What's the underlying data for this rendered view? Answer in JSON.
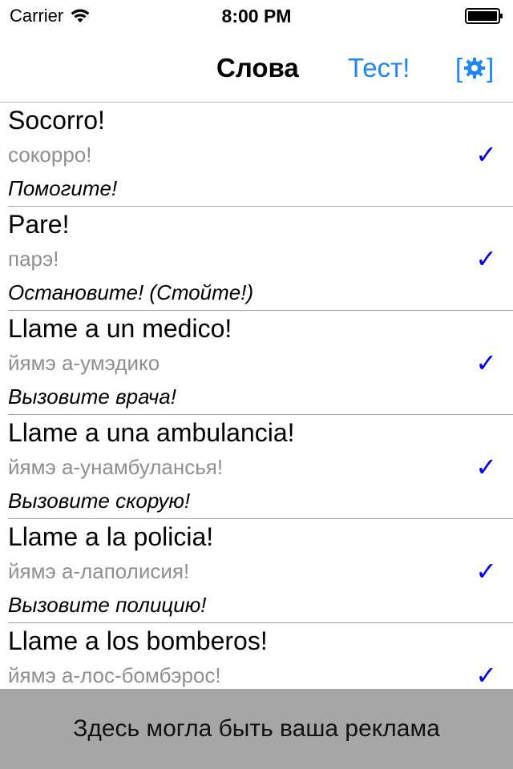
{
  "status_bar": {
    "carrier": "Carrier",
    "time": "8:00 PM"
  },
  "nav": {
    "title": "Слова",
    "test_label": "Тест!",
    "settings_left_bracket": "[",
    "settings_right_bracket": "]"
  },
  "rows": [
    {
      "spanish": "Socorro!",
      "transcription": "сокорро!",
      "translation": "Помогите!"
    },
    {
      "spanish": "Pare!",
      "transcription": "парэ!",
      "translation": "Остановите! (Стойте!)"
    },
    {
      "spanish": "Llame a un medico!",
      "transcription": "йямэ а-умэдико",
      "translation": "Вызовите врача!"
    },
    {
      "spanish": "Llame a una ambulancia!",
      "transcription": "йямэ а-унамбулансья!",
      "translation": "Вызовите скорую!"
    },
    {
      "spanish": "Llame a la policia!",
      "transcription": "йямэ а-лаполисия!",
      "translation": "Вызовите полицию!"
    },
    {
      "spanish": "Llame a los bomberos!",
      "transcription": "йямэ а-лос-бомбэрос!",
      "translation": ""
    }
  ],
  "check_glyph": "✓",
  "ad": {
    "text": "Здесь могла быть ваша реклама"
  },
  "colors": {
    "accent": "#1e87f0",
    "check": "#0000ee",
    "ad_background": "#a6a6a6"
  },
  "icons": [
    "wifi-icon",
    "battery-icon",
    "gear-icon",
    "check-icon"
  ]
}
